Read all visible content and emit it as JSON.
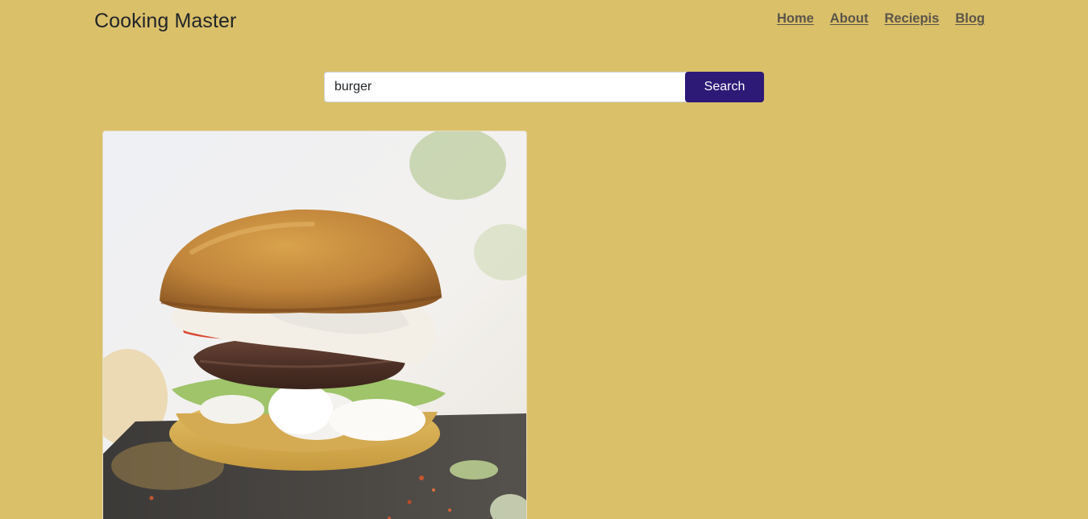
{
  "brand": {
    "title": "Cooking Master"
  },
  "nav": {
    "items": [
      {
        "label": "Home"
      },
      {
        "label": "About"
      },
      {
        "label": "Reciepis"
      },
      {
        "label": "Blog"
      }
    ]
  },
  "search": {
    "value": "burger",
    "button_label": "Search"
  },
  "colors": {
    "background": "#dbc06a",
    "search_button": "#2c1a76",
    "brand_text": "#212529",
    "nav_text": "#5a554a"
  },
  "results": [
    {
      "image": "burger-photo"
    }
  ]
}
